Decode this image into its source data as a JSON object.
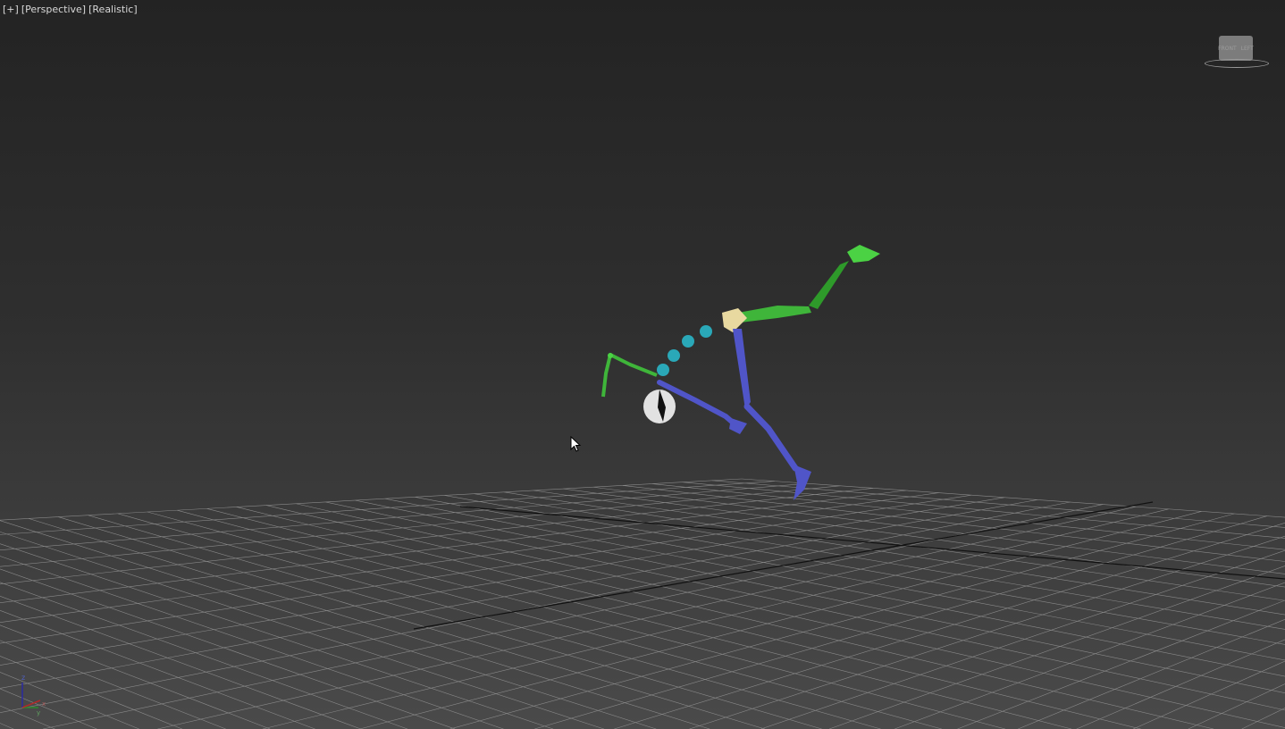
{
  "viewport": {
    "labels": [
      "[+]",
      "[Perspective]",
      "[Realistic]"
    ],
    "viewcube": {
      "front": "FRONT",
      "left": "LEFT"
    },
    "axis_gizmo": {
      "z": "z",
      "x": "x",
      "y": "y"
    },
    "colors": {
      "arms": "#3fb53a",
      "legs": "#5055c8",
      "spine": "#2aa8b8",
      "pelvis": "#e8d9a0",
      "head": "#e8e8e8"
    }
  }
}
